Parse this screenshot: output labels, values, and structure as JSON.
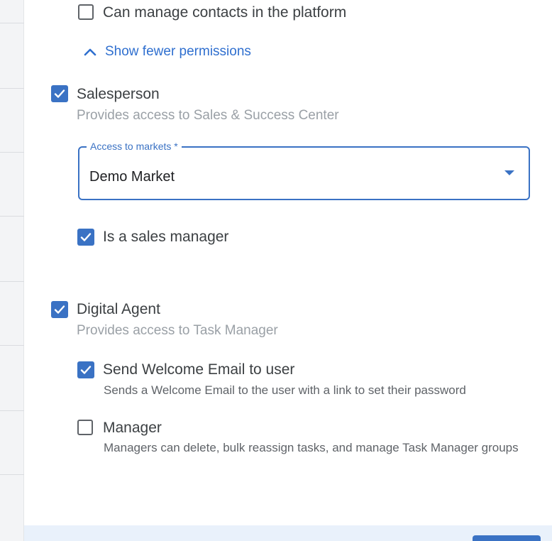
{
  "permissions": {
    "manage_contacts_label": "Can manage contacts in the platform",
    "show_fewer_label": "Show fewer permissions"
  },
  "salesperson": {
    "label": "Salesperson",
    "subtitle": "Provides access to Sales & Success Center",
    "checked": true,
    "markets_field": {
      "label": "Access to markets *",
      "value": "Demo Market"
    },
    "sales_manager_label": "Is a sales manager"
  },
  "digital_agent": {
    "label": "Digital Agent",
    "subtitle": "Provides access to Task Manager",
    "checked": true,
    "welcome_email": {
      "label": "Send Welcome Email to user",
      "description": "Sends a Welcome Email to the user with a link to set their password",
      "checked": true
    },
    "manager": {
      "label": "Manager",
      "description": "Managers can delete, bulk reassign tasks, and manage Task Manager groups",
      "checked": false
    }
  },
  "colors": {
    "accent": "#3a72c4",
    "link": "#2f6fcf",
    "muted_text": "#9aa0a6",
    "footer_bg": "#e9f1fb"
  }
}
